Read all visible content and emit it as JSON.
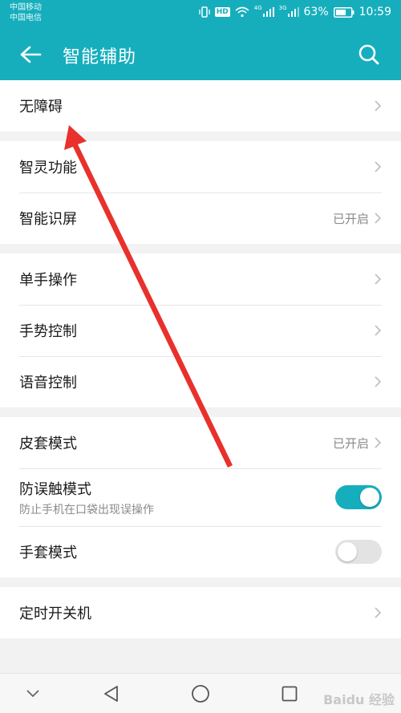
{
  "status_bar": {
    "carrier_1": "中国移动",
    "carrier_2": "中国电信",
    "battery_percent": "63%",
    "time": "10:59",
    "hd_label": "HD",
    "network_1": "4G",
    "network_2": "3G"
  },
  "header": {
    "title": "智能辅助",
    "back_icon": "back-arrow-icon",
    "search_icon": "search-icon"
  },
  "groups": [
    {
      "items": [
        {
          "label": "无障碍"
        }
      ]
    },
    {
      "items": [
        {
          "label": "智灵功能"
        },
        {
          "label": "智能识屏",
          "status": "已开启"
        }
      ]
    },
    {
      "items": [
        {
          "label": "单手操作"
        },
        {
          "label": "手势控制"
        },
        {
          "label": "语音控制"
        }
      ]
    },
    {
      "items": [
        {
          "label": "皮套模式",
          "status": "已开启"
        },
        {
          "label": "防误触模式",
          "sublabel": "防止手机在口袋出现误操作",
          "toggle": "on"
        },
        {
          "label": "手套模式",
          "toggle": "off"
        }
      ]
    },
    {
      "items": [
        {
          "label": "定时开关机"
        }
      ]
    }
  ],
  "nav_bar": {
    "icons": [
      "down-chevron-icon",
      "back-triangle-icon",
      "home-circle-icon",
      "recents-square-icon"
    ]
  },
  "watermark": "Baidu 经验",
  "colors": {
    "accent": "#16aebd",
    "arrow": "#e8312c"
  }
}
